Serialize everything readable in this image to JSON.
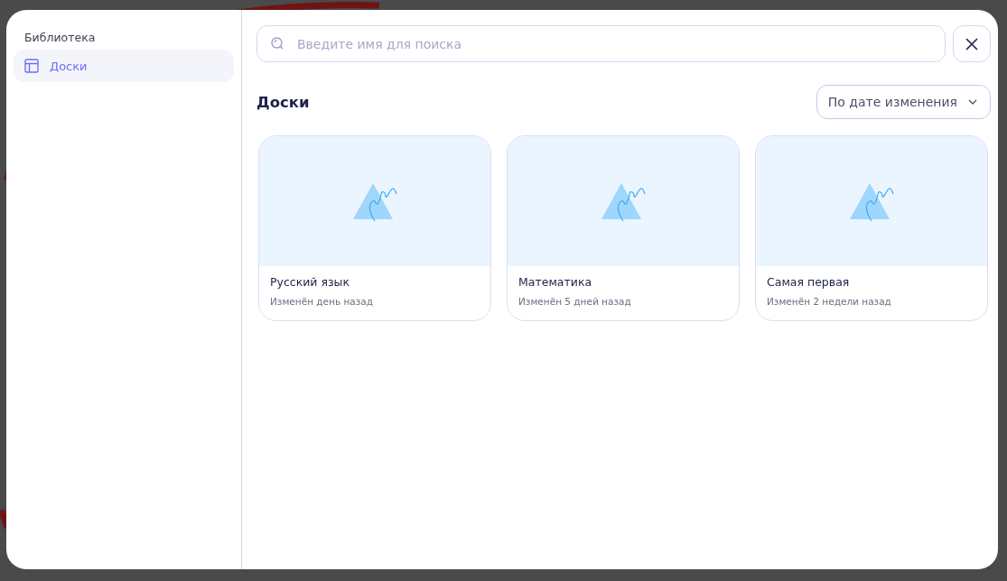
{
  "sidebar": {
    "title": "Библиотека",
    "items": [
      {
        "label": "Доски",
        "selected": true
      }
    ]
  },
  "search": {
    "placeholder": "Введите имя для поиска"
  },
  "section": {
    "title": "Доски",
    "sort": "По дате изменения"
  },
  "boards": [
    {
      "title": "Русский язык",
      "subtitle": "Изменён день назад"
    },
    {
      "title": "Математика",
      "subtitle": "Изменён 5 дней назад"
    },
    {
      "title": "Самая первая",
      "subtitle": "Изменён 2 недели назад"
    }
  ]
}
